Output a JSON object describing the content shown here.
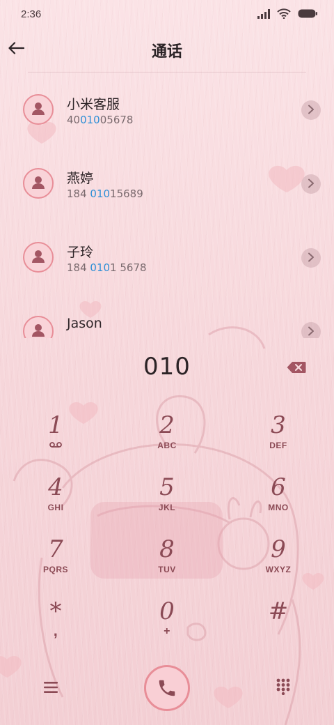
{
  "status_bar": {
    "time": "2:36",
    "icons": [
      "signal-icon",
      "wifi-icon",
      "battery-icon"
    ]
  },
  "header": {
    "title": "通话",
    "back_icon": "back-arrow-icon"
  },
  "query": "010",
  "contacts": [
    {
      "name": "小米客服",
      "number_parts": [
        {
          "t": "40",
          "hl": false
        },
        {
          "t": "010",
          "hl": true
        },
        {
          "t": "05678",
          "hl": false
        }
      ]
    },
    {
      "name": "燕婷",
      "number_parts": [
        {
          "t": "184 ",
          "hl": false
        },
        {
          "t": "010",
          "hl": true
        },
        {
          "t": "15689",
          "hl": false
        }
      ]
    },
    {
      "name": "子玲",
      "number_parts": [
        {
          "t": "184 ",
          "hl": false
        },
        {
          "t": "010",
          "hl": true
        },
        {
          "t": "1 5678",
          "hl": false
        }
      ]
    },
    {
      "name": "Jason",
      "number_parts": []
    }
  ],
  "dialed_number": "010",
  "keypad": [
    {
      "digit": "1",
      "letters": "",
      "icon": "voicemail-icon"
    },
    {
      "digit": "2",
      "letters": "ABC"
    },
    {
      "digit": "3",
      "letters": "DEF"
    },
    {
      "digit": "4",
      "letters": "GHI"
    },
    {
      "digit": "5",
      "letters": "JKL"
    },
    {
      "digit": "6",
      "letters": "MNO"
    },
    {
      "digit": "7",
      "letters": "PQRS"
    },
    {
      "digit": "8",
      "letters": "TUV"
    },
    {
      "digit": "9",
      "letters": "WXYZ"
    },
    {
      "digit": "*",
      "letters": ",",
      "icon": ""
    },
    {
      "digit": "0",
      "letters": "+"
    },
    {
      "digit": "#",
      "letters": ""
    }
  ],
  "colors": {
    "accent": "#e88e98",
    "key_text": "#8b4a55",
    "highlight": "#2e8fd6",
    "background": "#f8dde0"
  },
  "bottom_bar": {
    "menu_icon": "menu-icon",
    "call_icon": "phone-icon",
    "keypad_icon": "dialpad-icon"
  }
}
